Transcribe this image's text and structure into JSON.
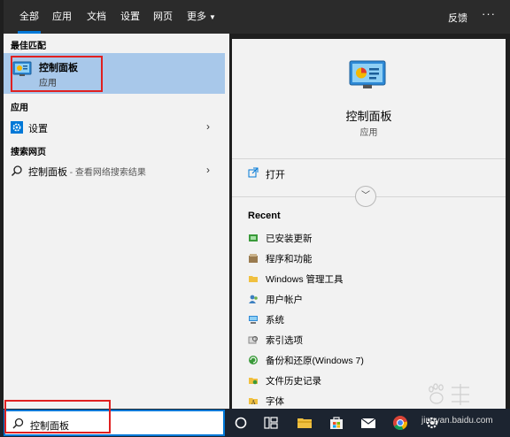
{
  "tabs": [
    {
      "label": "全部",
      "active": true
    },
    {
      "label": "应用",
      "active": false
    },
    {
      "label": "文档",
      "active": false
    },
    {
      "label": "设置",
      "active": false
    },
    {
      "label": "网页",
      "active": false
    },
    {
      "label": "更多",
      "active": false
    }
  ],
  "header": {
    "feedback": "反馈",
    "more_menu": "···"
  },
  "left": {
    "best_match_heading": "最佳匹配",
    "best_match": {
      "title": "控制面板",
      "subtitle": "应用",
      "icon": "control-panel-icon"
    },
    "apps_heading": "应用",
    "apps": [
      {
        "label": "设置",
        "icon": "gear-icon"
      }
    ],
    "web_heading": "搜索网页",
    "web": [
      {
        "label": "控制面板",
        "suffix": " - 查看网络搜索结果",
        "icon": "search-icon"
      }
    ]
  },
  "right": {
    "title": "控制面板",
    "type": "应用",
    "open_label": "打开",
    "recent_heading": "Recent",
    "recent": [
      {
        "label": "已安装更新",
        "icon": "updates-icon"
      },
      {
        "label": "程序和功能",
        "icon": "programs-icon"
      },
      {
        "label": "Windows 管理工具",
        "icon": "folder-icon"
      },
      {
        "label": "用户帐户",
        "icon": "user-accounts-icon"
      },
      {
        "label": "系统",
        "icon": "system-icon"
      },
      {
        "label": "索引选项",
        "icon": "indexing-icon"
      },
      {
        "label": "备份和还原(Windows 7)",
        "icon": "backup-icon"
      },
      {
        "label": "文件历史记录",
        "icon": "file-history-icon"
      },
      {
        "label": "字体",
        "icon": "fonts-icon"
      }
    ]
  },
  "search": {
    "value": "控制面板"
  },
  "watermark": "jingyan.baidu.com",
  "colors": {
    "accent": "#0078d7",
    "highlight": "#a8c8ea",
    "annotation": "#e02020",
    "taskbar": "#1c2430"
  }
}
